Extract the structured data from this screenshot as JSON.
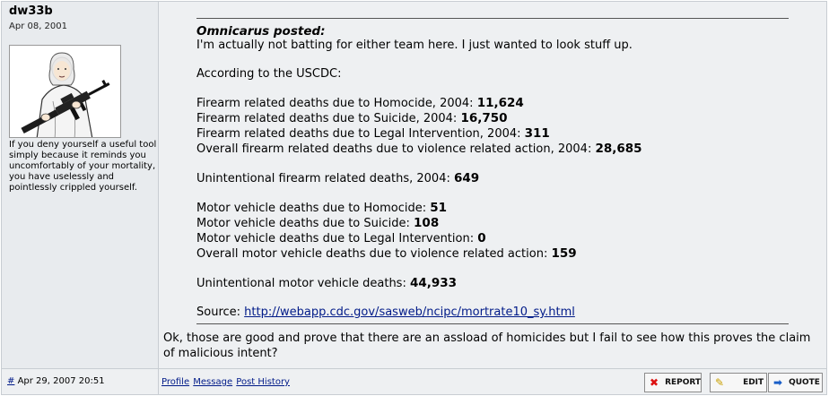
{
  "user": {
    "name": "dw33b",
    "joined": "Apr 08, 2001",
    "signature": "If you deny yourself a useful tool simply because it reminds you uncomfortably of your mortality, you have uselessly and pointlessly crippled yourself."
  },
  "quote": {
    "author": "Omnicarus posted:",
    "intro": "I'm actually not batting for either team here. I just wanted to look stuff up.",
    "according": "According to the USCDC:",
    "firearm_stats": [
      {
        "label": "Firearm related deaths due to Homocide, 2004: ",
        "value": "11,624"
      },
      {
        "label": "Firearm related deaths due to Suicide, 2004: ",
        "value": "16,750"
      },
      {
        "label": "Firearm related deaths due to Legal Intervention, 2004: ",
        "value": "311"
      },
      {
        "label": "Overall firearm related deaths due to violence related action, 2004: ",
        "value": "28,685"
      }
    ],
    "unintentional_firearm": {
      "label": "Unintentional firearm related deaths, 2004: ",
      "value": "649"
    },
    "vehicle_stats": [
      {
        "label": "Motor vehicle deaths due to Homocide: ",
        "value": "51"
      },
      {
        "label": "Motor vehicle deaths due to Suicide: ",
        "value": "108"
      },
      {
        "label": "Motor vehicle deaths due to Legal Intervention: ",
        "value": "0"
      },
      {
        "label": "Overall motor vehicle deaths due to violence related action: ",
        "value": "159"
      }
    ],
    "unintentional_vehicle": {
      "label": "Unintentional motor vehicle deaths: ",
      "value": "44,933"
    },
    "source_label": "Source: ",
    "source_link": "http://webapp.cdc.gov/sasweb/ncipc/mortrate10_sy.html"
  },
  "reply": "Ok, those are good and prove that there are an assload of homicides but I fail to see how this proves the claim of malicious intent?",
  "footer": {
    "permalink": "#",
    "date": "Apr 29, 2007 20:51",
    "links": [
      "Profile",
      "Message",
      "Post History"
    ],
    "buttons": {
      "report": "REPORT",
      "edit": "EDIT",
      "quote": "QUOTE"
    }
  }
}
